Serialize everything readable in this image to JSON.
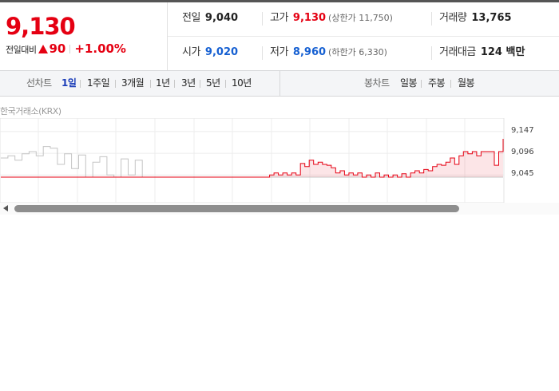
{
  "price": {
    "current": "9,130",
    "change_label": "전일대비",
    "change_icon": "up-triangle-icon",
    "change_amount": "90",
    "change_rate": "+1.00%"
  },
  "stats": {
    "prev_close": {
      "label": "전일",
      "value": "9,040"
    },
    "high": {
      "label": "고가",
      "value": "9,130",
      "sub": "(상한가 11,750)"
    },
    "volume": {
      "label": "거래량",
      "value": "13,765"
    },
    "open": {
      "label": "시가",
      "value": "9,020"
    },
    "low": {
      "label": "저가",
      "value": "8,960",
      "sub": "(하한가 6,330)"
    },
    "trade_amount": {
      "label": "거래대금",
      "value": "124 백만"
    }
  },
  "colors": {
    "up": "#e50012",
    "down": "#1660d2",
    "active_tab": "#1a3cb8"
  },
  "line_tabs": {
    "label": "선차트",
    "items": [
      "1일",
      "1주일",
      "3개월",
      "1년",
      "3년",
      "5년",
      "10년"
    ],
    "active": "1일"
  },
  "candle_tabs": {
    "label": "봉차트",
    "items": [
      "일봉",
      "주봉",
      "월봉"
    ]
  },
  "chart_source": "한국거래소(KRX)",
  "chart_data": {
    "type": "line",
    "ylim": [
      8980,
      9160
    ],
    "y_ticks": [
      {
        "value": 9147,
        "label": "9,147"
      },
      {
        "value": 9096,
        "label": "9,096"
      },
      {
        "value": 9045,
        "label": "9,045"
      }
    ],
    "prev_close": 9040,
    "series": [
      {
        "color": "#c4c4c4",
        "values": [
          9085,
          9090,
          9080,
          9095,
          9100,
          9090,
          9112,
          9108,
          9070,
          9095,
          9060,
          9092,
          9040,
          9075,
          9088,
          9045,
          9040,
          9083,
          9045,
          9080,
          9040,
          9040,
          9040,
          9040,
          9040,
          9040,
          9040,
          9040,
          9040,
          9040,
          9040,
          9040,
          9040,
          9040,
          9040,
          9040,
          9040,
          9040,
          9040,
          9040,
          9040,
          9040,
          9040,
          9040,
          9040,
          9040,
          9040,
          9040,
          9040,
          9040,
          9040,
          9040,
          9040,
          9040,
          9040,
          9040,
          9040,
          9040,
          9040,
          9040,
          9040,
          9040,
          9040,
          9040,
          9040,
          9040,
          9040,
          9040,
          9040,
          9040,
          9040,
          9040
        ]
      },
      {
        "color": "#e50012",
        "values": [
          9040,
          9040,
          9040,
          9040,
          9040,
          9040,
          9040,
          9040,
          9040,
          9040,
          9040,
          9040,
          9040,
          9040,
          9040,
          9040,
          9040,
          9040,
          9040,
          9040,
          9040,
          9040,
          9040,
          9040,
          9040,
          9040,
          9040,
          9040,
          9040,
          9040,
          9040,
          9040,
          9040,
          9040,
          9040,
          9040,
          9040,
          9040,
          9040,
          9040,
          9040,
          9040,
          9040,
          9040,
          9040,
          9040,
          9040,
          9040,
          9040,
          9040,
          9040,
          9040,
          9040,
          9040,
          9040,
          9040,
          9040,
          9040,
          9040,
          9040,
          9040,
          9045,
          9050,
          9045,
          9050,
          9045,
          9050,
          9045,
          9072,
          9065,
          9080,
          9070,
          9075,
          9070,
          9068,
          9062,
          9050,
          9055,
          9045,
          9050,
          9045,
          9050,
          9040,
          9045,
          9040,
          9050,
          9040,
          9045,
          9040,
          9045,
          9040,
          9048,
          9040,
          9050,
          9055,
          9050,
          9058,
          9055,
          9065,
          9070,
          9068,
          9075,
          9085,
          9070,
          9090,
          9100,
          9095,
          9100,
          9090,
          9100,
          9100,
          9100,
          9068,
          9100,
          9130
        ]
      }
    ]
  }
}
